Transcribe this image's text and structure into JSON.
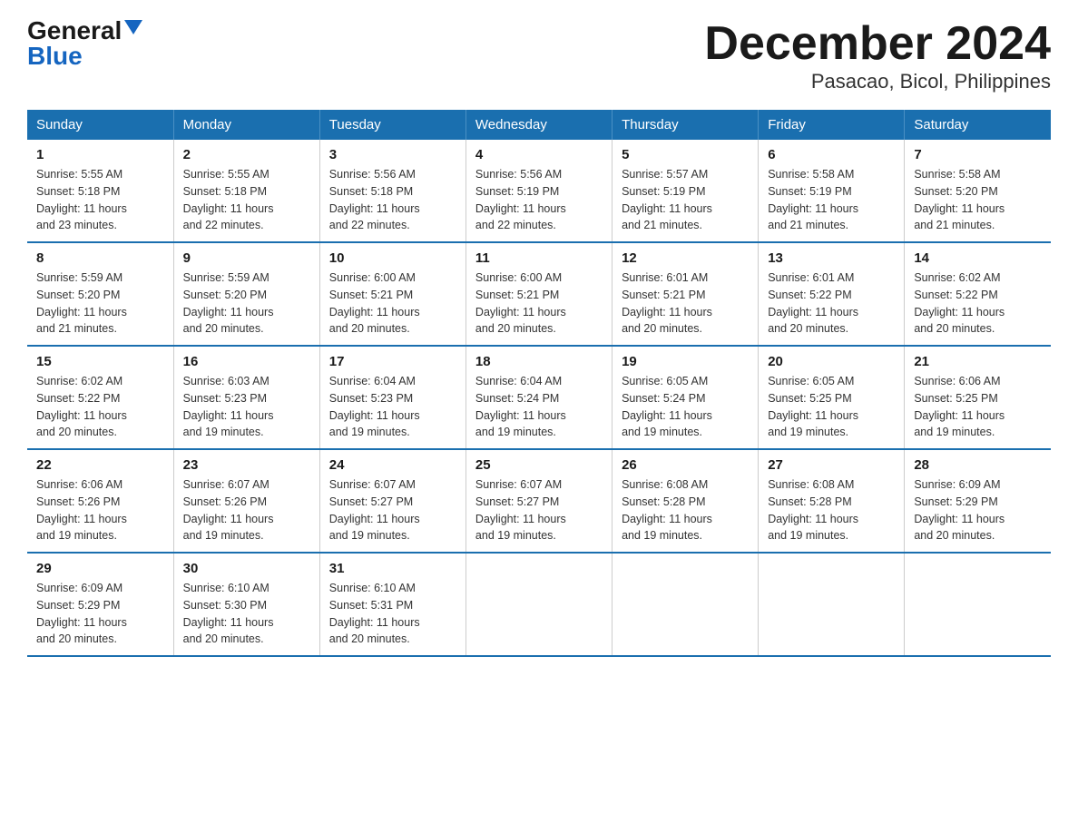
{
  "logo": {
    "general": "General",
    "blue": "Blue"
  },
  "title": "December 2024",
  "subtitle": "Pasacao, Bicol, Philippines",
  "days_of_week": [
    "Sunday",
    "Monday",
    "Tuesday",
    "Wednesday",
    "Thursday",
    "Friday",
    "Saturday"
  ],
  "weeks": [
    [
      {
        "day": "1",
        "sunrise": "5:55 AM",
        "sunset": "5:18 PM",
        "daylight": "11 hours and 23 minutes."
      },
      {
        "day": "2",
        "sunrise": "5:55 AM",
        "sunset": "5:18 PM",
        "daylight": "11 hours and 22 minutes."
      },
      {
        "day": "3",
        "sunrise": "5:56 AM",
        "sunset": "5:18 PM",
        "daylight": "11 hours and 22 minutes."
      },
      {
        "day": "4",
        "sunrise": "5:56 AM",
        "sunset": "5:19 PM",
        "daylight": "11 hours and 22 minutes."
      },
      {
        "day": "5",
        "sunrise": "5:57 AM",
        "sunset": "5:19 PM",
        "daylight": "11 hours and 21 minutes."
      },
      {
        "day": "6",
        "sunrise": "5:58 AM",
        "sunset": "5:19 PM",
        "daylight": "11 hours and 21 minutes."
      },
      {
        "day": "7",
        "sunrise": "5:58 AM",
        "sunset": "5:20 PM",
        "daylight": "11 hours and 21 minutes."
      }
    ],
    [
      {
        "day": "8",
        "sunrise": "5:59 AM",
        "sunset": "5:20 PM",
        "daylight": "11 hours and 21 minutes."
      },
      {
        "day": "9",
        "sunrise": "5:59 AM",
        "sunset": "5:20 PM",
        "daylight": "11 hours and 20 minutes."
      },
      {
        "day": "10",
        "sunrise": "6:00 AM",
        "sunset": "5:21 PM",
        "daylight": "11 hours and 20 minutes."
      },
      {
        "day": "11",
        "sunrise": "6:00 AM",
        "sunset": "5:21 PM",
        "daylight": "11 hours and 20 minutes."
      },
      {
        "day": "12",
        "sunrise": "6:01 AM",
        "sunset": "5:21 PM",
        "daylight": "11 hours and 20 minutes."
      },
      {
        "day": "13",
        "sunrise": "6:01 AM",
        "sunset": "5:22 PM",
        "daylight": "11 hours and 20 minutes."
      },
      {
        "day": "14",
        "sunrise": "6:02 AM",
        "sunset": "5:22 PM",
        "daylight": "11 hours and 20 minutes."
      }
    ],
    [
      {
        "day": "15",
        "sunrise": "6:02 AM",
        "sunset": "5:22 PM",
        "daylight": "11 hours and 20 minutes."
      },
      {
        "day": "16",
        "sunrise": "6:03 AM",
        "sunset": "5:23 PM",
        "daylight": "11 hours and 19 minutes."
      },
      {
        "day": "17",
        "sunrise": "6:04 AM",
        "sunset": "5:23 PM",
        "daylight": "11 hours and 19 minutes."
      },
      {
        "day": "18",
        "sunrise": "6:04 AM",
        "sunset": "5:24 PM",
        "daylight": "11 hours and 19 minutes."
      },
      {
        "day": "19",
        "sunrise": "6:05 AM",
        "sunset": "5:24 PM",
        "daylight": "11 hours and 19 minutes."
      },
      {
        "day": "20",
        "sunrise": "6:05 AM",
        "sunset": "5:25 PM",
        "daylight": "11 hours and 19 minutes."
      },
      {
        "day": "21",
        "sunrise": "6:06 AM",
        "sunset": "5:25 PM",
        "daylight": "11 hours and 19 minutes."
      }
    ],
    [
      {
        "day": "22",
        "sunrise": "6:06 AM",
        "sunset": "5:26 PM",
        "daylight": "11 hours and 19 minutes."
      },
      {
        "day": "23",
        "sunrise": "6:07 AM",
        "sunset": "5:26 PM",
        "daylight": "11 hours and 19 minutes."
      },
      {
        "day": "24",
        "sunrise": "6:07 AM",
        "sunset": "5:27 PM",
        "daylight": "11 hours and 19 minutes."
      },
      {
        "day": "25",
        "sunrise": "6:07 AM",
        "sunset": "5:27 PM",
        "daylight": "11 hours and 19 minutes."
      },
      {
        "day": "26",
        "sunrise": "6:08 AM",
        "sunset": "5:28 PM",
        "daylight": "11 hours and 19 minutes."
      },
      {
        "day": "27",
        "sunrise": "6:08 AM",
        "sunset": "5:28 PM",
        "daylight": "11 hours and 19 minutes."
      },
      {
        "day": "28",
        "sunrise": "6:09 AM",
        "sunset": "5:29 PM",
        "daylight": "11 hours and 20 minutes."
      }
    ],
    [
      {
        "day": "29",
        "sunrise": "6:09 AM",
        "sunset": "5:29 PM",
        "daylight": "11 hours and 20 minutes."
      },
      {
        "day": "30",
        "sunrise": "6:10 AM",
        "sunset": "5:30 PM",
        "daylight": "11 hours and 20 minutes."
      },
      {
        "day": "31",
        "sunrise": "6:10 AM",
        "sunset": "5:31 PM",
        "daylight": "11 hours and 20 minutes."
      },
      null,
      null,
      null,
      null
    ]
  ],
  "labels": {
    "sunrise": "Sunrise:",
    "sunset": "Sunset:",
    "daylight": "Daylight:"
  }
}
